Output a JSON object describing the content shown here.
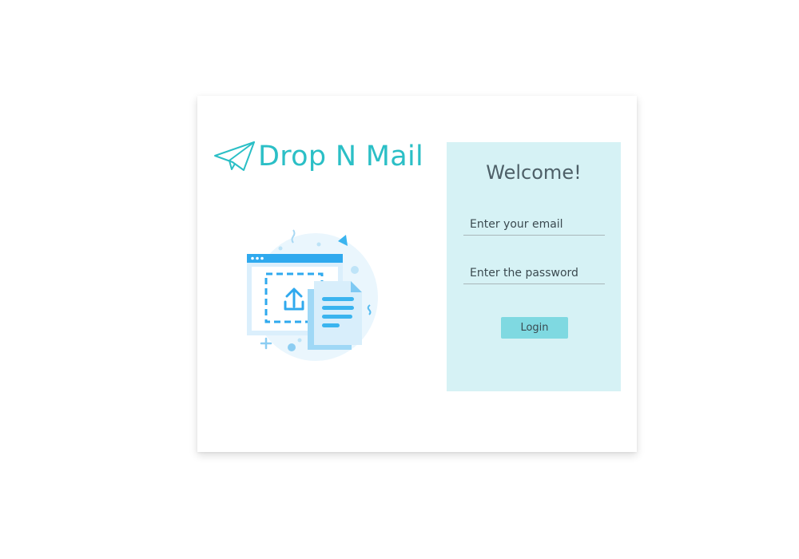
{
  "brand": {
    "name": "Drop N Mail",
    "icon": "paper-plane-icon",
    "color": "#2bbfc6"
  },
  "illustration": {
    "icon": "file-upload-illustration"
  },
  "login": {
    "welcome": "Welcome!",
    "email_placeholder": "Enter your email",
    "email_value": "",
    "password_placeholder": "Enter the password",
    "password_value": "",
    "button_label": "Login",
    "panel_color": "#d6f2f5",
    "button_color": "#7fd9e1"
  }
}
